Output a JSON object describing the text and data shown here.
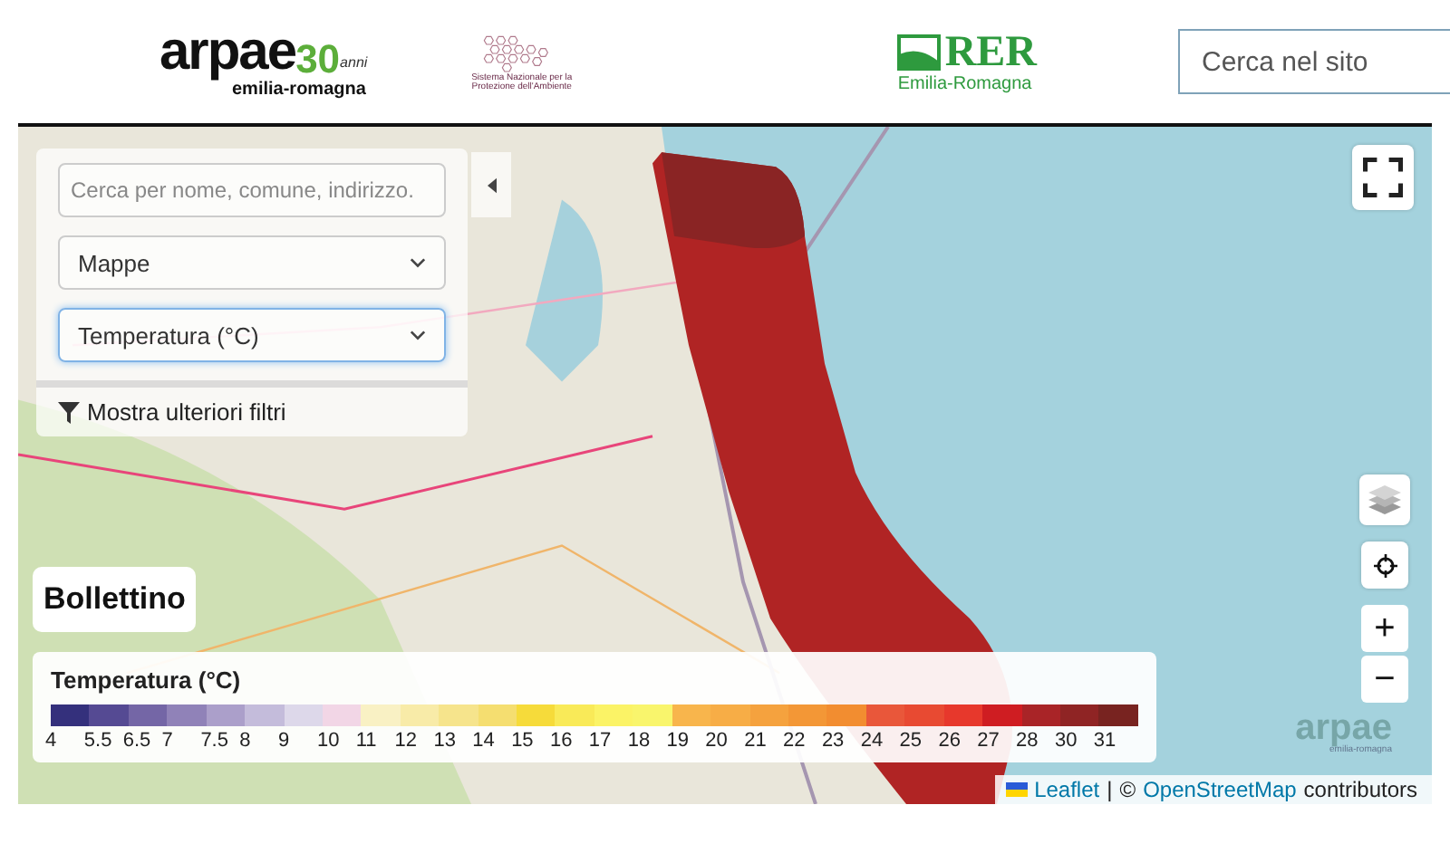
{
  "header": {
    "arpae_logo": {
      "name": "arpae",
      "anniversary": "30",
      "anni": "anni",
      "region": "emilia-romagna"
    },
    "snpa_logo": {
      "text": "Sistema Nazionale per la Protezione dell'Ambiente"
    },
    "rer_logo": {
      "name": "RER",
      "region": "Emilia-Romagna"
    },
    "search": {
      "placeholder": "Cerca nel sito"
    }
  },
  "map": {
    "search": {
      "placeholder": "Cerca per nome, comune, indirizzo."
    },
    "selects": [
      {
        "value": "Mappe",
        "focused": false
      },
      {
        "value": "Temperatura (°C)",
        "focused": true
      }
    ],
    "filters_button": "Mostra ulteriori filtri",
    "bulletin_button": "Bollettino",
    "zoom_in": "+",
    "zoom_out": "−",
    "legend": {
      "title": "Temperatura (°C)",
      "items": [
        {
          "label": "4",
          "color": "#34307c"
        },
        {
          "label": "5.5",
          "color": "#554a93"
        },
        {
          "label": "6.5",
          "color": "#7466a6"
        },
        {
          "label": "7",
          "color": "#9082b8"
        },
        {
          "label": "7.5",
          "color": "#ab9fca"
        },
        {
          "label": "8",
          "color": "#c4bcdb"
        },
        {
          "label": "9",
          "color": "#ddd8ea"
        },
        {
          "label": "10",
          "color": "#f2d6e6"
        },
        {
          "label": "11",
          "color": "#f9f1c4"
        },
        {
          "label": "12",
          "color": "#f8eba8"
        },
        {
          "label": "13",
          "color": "#f6e48c"
        },
        {
          "label": "14",
          "color": "#f5de70"
        },
        {
          "label": "15",
          "color": "#f6db3a"
        },
        {
          "label": "16",
          "color": "#f9ea58"
        },
        {
          "label": "17",
          "color": "#fbf366"
        },
        {
          "label": "18",
          "color": "#f9f56c"
        },
        {
          "label": "19",
          "color": "#f8b54c"
        },
        {
          "label": "20",
          "color": "#f7ad46"
        },
        {
          "label": "21",
          "color": "#f5a23e"
        },
        {
          "label": "22",
          "color": "#f39736"
        },
        {
          "label": "23",
          "color": "#f28d30"
        },
        {
          "label": "24",
          "color": "#e9573a"
        },
        {
          "label": "25",
          "color": "#e84a32"
        },
        {
          "label": "26",
          "color": "#e7382c"
        },
        {
          "label": "27",
          "color": "#cf1d22"
        },
        {
          "label": "28",
          "color": "#a92427"
        },
        {
          "label": "30",
          "color": "#8f2424"
        },
        {
          "label": "31",
          "color": "#782320"
        }
      ]
    },
    "watermark": {
      "name": "arpae",
      "region": "emilia-romagna"
    },
    "attribution": {
      "leaflet": "Leaflet",
      "separator": "|",
      "copyright": "©",
      "osm": "OpenStreetMap",
      "contributors": "contributors"
    }
  }
}
